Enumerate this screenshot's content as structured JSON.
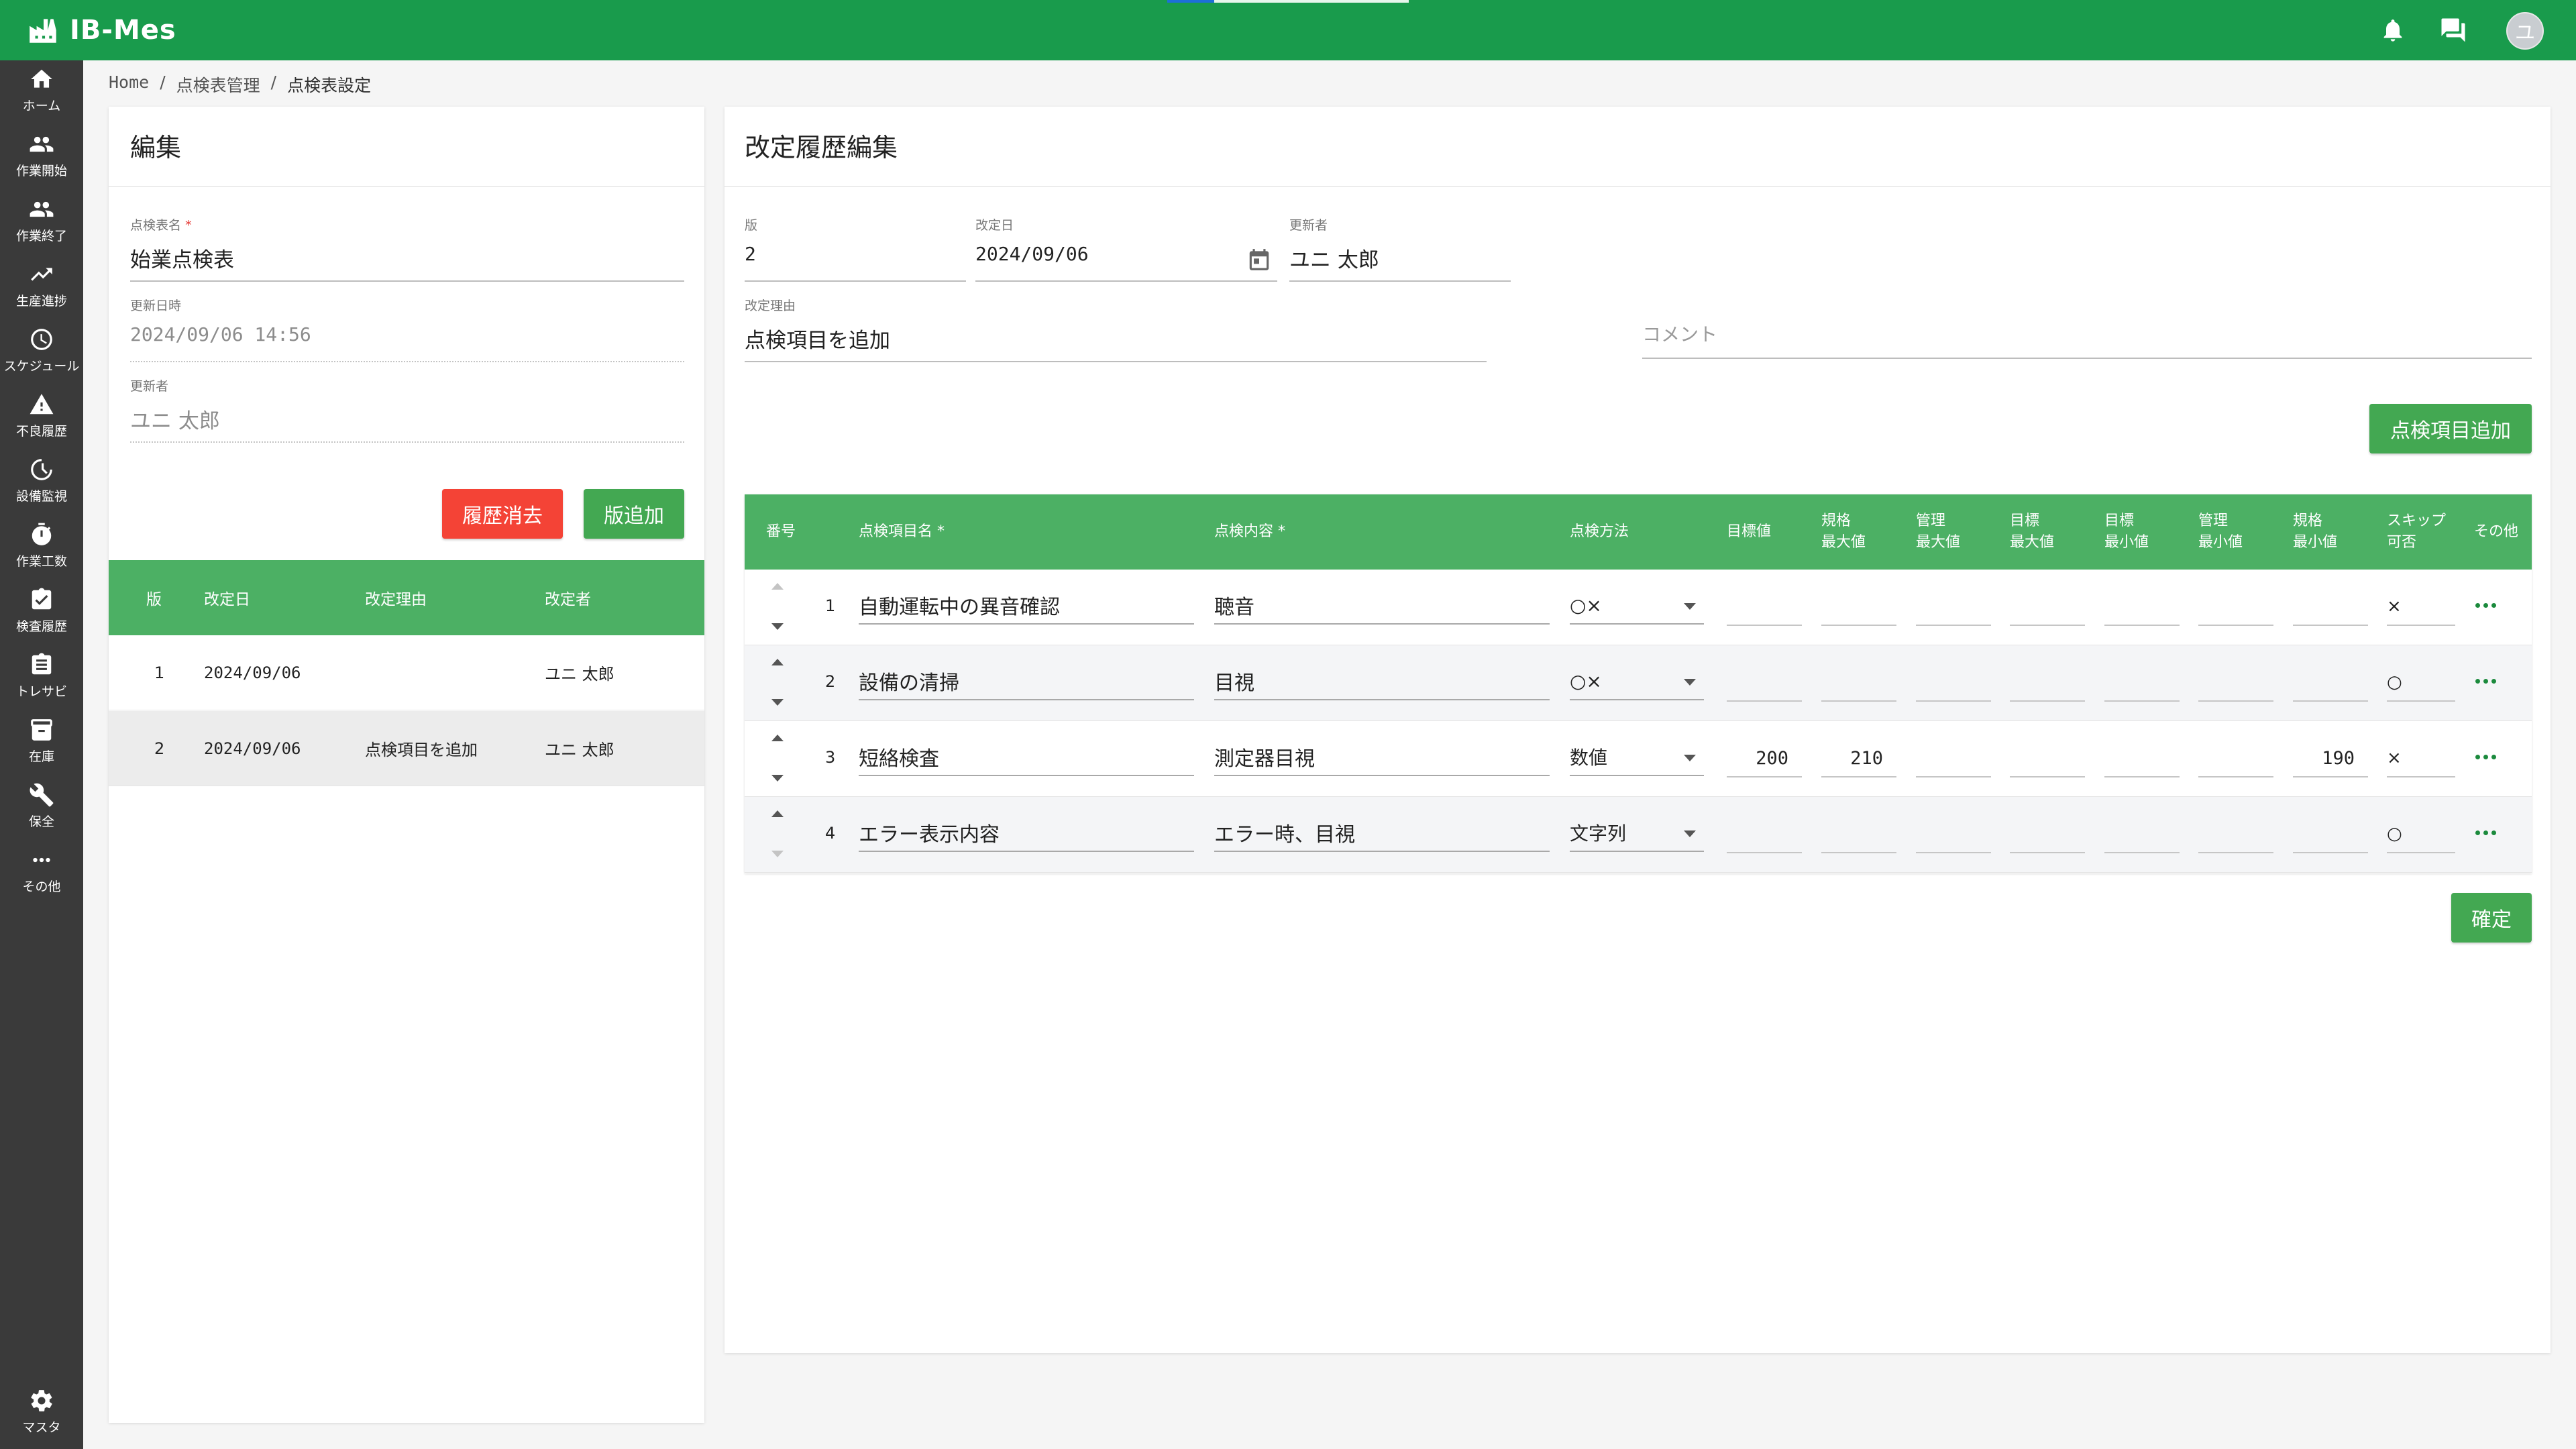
{
  "app": {
    "title": "IB-Mes",
    "avatar_initial": "ユ"
  },
  "colors": {
    "header": "#199b4c",
    "table_header": "#4cb064",
    "accent_green": "#43a852",
    "danger": "#f44336",
    "sidebar": "#3a3a3a"
  },
  "sidebar": {
    "items": [
      {
        "label": "ホーム",
        "icon": "home-icon"
      },
      {
        "label": "作業開始",
        "icon": "people-icon"
      },
      {
        "label": "作業終了",
        "icon": "people-icon"
      },
      {
        "label": "生産進捗",
        "icon": "trending-up-icon"
      },
      {
        "label": "スケジュール",
        "icon": "clock-icon"
      },
      {
        "label": "不良履歴",
        "icon": "warning-icon"
      },
      {
        "label": "設備監視",
        "icon": "timer-icon"
      },
      {
        "label": "作業工数",
        "icon": "stopwatch-icon"
      },
      {
        "label": "検査履歴",
        "icon": "checkbox-icon"
      },
      {
        "label": "トレサビ",
        "icon": "document-icon"
      },
      {
        "label": "在庫",
        "icon": "inventory-icon"
      },
      {
        "label": "保全",
        "icon": "wrench-icon"
      },
      {
        "label": "その他",
        "icon": "more-icon"
      }
    ],
    "bottom": {
      "label": "マスタ",
      "icon": "gear-icon"
    }
  },
  "breadcrumb": {
    "home": "Home",
    "sep": "/",
    "level1": "点検表管理",
    "current": "点検表設定"
  },
  "edit_panel": {
    "title": "編集",
    "name_label": "点検表名",
    "required_mark": "*",
    "name_value": "始業点検表",
    "updated_label": "更新日時",
    "updated_value": "2024/09/06 14:56",
    "updater_label": "更新者",
    "updater_value": "ユニ 太郎",
    "delete_button": "履歴消去",
    "add_version_button": "版追加",
    "history_table": {
      "headers": {
        "version": "版",
        "date": "改定日",
        "reason": "改定理由",
        "author": "改定者"
      },
      "rows": [
        {
          "version": "1",
          "date": "2024/09/06",
          "reason": "",
          "author": "ユニ 太郎"
        },
        {
          "version": "2",
          "date": "2024/09/06",
          "reason": "点検項目を追加",
          "author": "ユニ 太郎"
        }
      ]
    }
  },
  "revision_panel": {
    "title": "改定履歴編集",
    "version_label": "版",
    "version_value": "2",
    "date_label": "改定日",
    "date_value": "2024/09/06",
    "updater_label": "更新者",
    "updater_value": "ユニ 太郎",
    "reason_label": "改定理由",
    "reason_value": "点検項目を追加",
    "comment_placeholder": "コメント",
    "add_item_button": "点検項目追加",
    "confirm_button": "確定",
    "table": {
      "headers": {
        "no": "番号",
        "name": "点検項目名",
        "content": "点検内容",
        "required_mark": "*",
        "method": "点検方法",
        "target": "目標値",
        "spec_max": [
          "規格",
          "最大値"
        ],
        "ctrl_max": [
          "管理",
          "最大値"
        ],
        "tgt_max": [
          "目標",
          "最大値"
        ],
        "tgt_min": [
          "目標",
          "最小値"
        ],
        "ctrl_min": [
          "管理",
          "最小値"
        ],
        "spec_min": [
          "規格",
          "最小値"
        ],
        "skip": [
          "スキップ",
          "可否"
        ],
        "other": "その他"
      },
      "rows": [
        {
          "no": "1",
          "name": "自動運転中の異音確認",
          "content": "聴音",
          "method": "○×",
          "target": "",
          "spec_max": "",
          "ctrl_max": "",
          "tgt_max": "",
          "tgt_min": "",
          "ctrl_min": "",
          "spec_min": "",
          "skip": "×"
        },
        {
          "no": "2",
          "name": "設備の清掃",
          "content": "目視",
          "method": "○×",
          "target": "",
          "spec_max": "",
          "ctrl_max": "",
          "tgt_max": "",
          "tgt_min": "",
          "ctrl_min": "",
          "spec_min": "",
          "skip": "○"
        },
        {
          "no": "3",
          "name": "短絡検査",
          "content": "測定器目視",
          "method": "数値",
          "target": "200",
          "spec_max": "210",
          "ctrl_max": "",
          "tgt_max": "",
          "tgt_min": "",
          "ctrl_min": "",
          "spec_min": "190",
          "skip": "×"
        },
        {
          "no": "4",
          "name": "エラー表示内容",
          "content": "エラー時、目視",
          "method": "文字列",
          "target": "",
          "spec_max": "",
          "ctrl_max": "",
          "tgt_max": "",
          "tgt_min": "",
          "ctrl_min": "",
          "spec_min": "",
          "skip": "○"
        }
      ]
    }
  }
}
